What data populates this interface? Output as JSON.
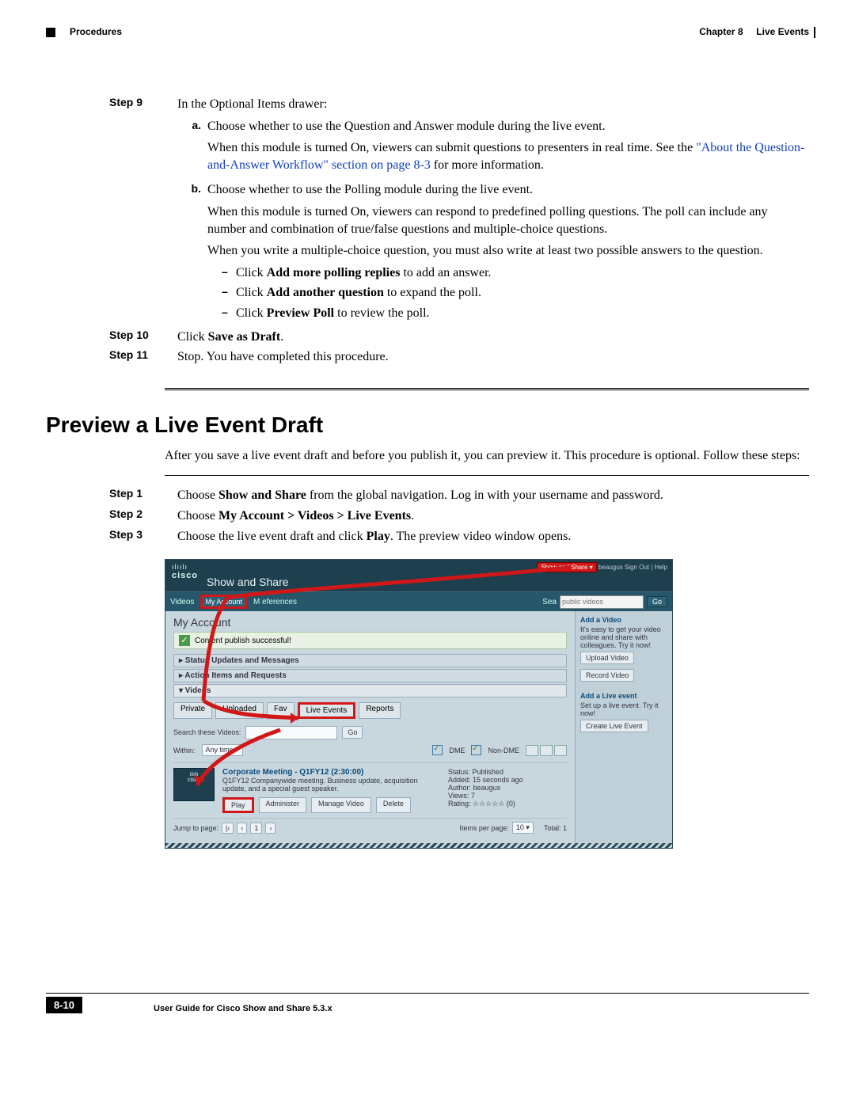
{
  "header": {
    "left": "Procedures",
    "right_chapter": "Chapter 8",
    "right_title": "Live Events"
  },
  "step9": {
    "label": "Step 9",
    "intro": "In the Optional Items drawer:",
    "a": {
      "label": "a.",
      "line1": "Choose whether to use the Question and Answer module during the live event.",
      "line2a": "When this module is turned On, viewers can submit questions to presenters in real time. See the ",
      "link": "\"About the Question-and-Answer Workflow\" section on page 8-3",
      "line2b": " for more information."
    },
    "b": {
      "label": "b.",
      "line1": "Choose whether to use the Polling module during the live event.",
      "line2": "When this module is turned On, viewers can respond to predefined polling questions. The poll can include any number and combination of true/false questions and multiple-choice questions.",
      "line3": "When you write a multiple-choice question, you must also write at least two possible answers to the question.",
      "bullet1a": "Click ",
      "bullet1b": "Add more polling replies",
      "bullet1c": " to add an answer.",
      "bullet2a": "Click ",
      "bullet2b": "Add another question",
      "bullet2c": " to expand the poll.",
      "bullet3a": "Click ",
      "bullet3b": "Preview Poll",
      "bullet3c": " to review the poll."
    }
  },
  "step10": {
    "label": "Step 10",
    "text_a": "Click ",
    "text_b": "Save as Draft",
    "text_c": "."
  },
  "step11": {
    "label": "Step 11",
    "text": "Stop. You have completed this procedure."
  },
  "section_title": "Preview a Live Event Draft",
  "section_intro": "After you save a live event draft and before you publish it, you can preview it. This procedure is optional. Follow these steps:",
  "pstep1": {
    "label": "Step 1",
    "a": "Choose ",
    "b": "Show and Share",
    "c": " from the global navigation. Log in with your username and password."
  },
  "pstep2": {
    "label": "Step 2",
    "a": "Choose ",
    "b": "My Account > Videos > Live Events",
    "c": "."
  },
  "pstep3": {
    "label": "Step 3",
    "a": "Choose the live event draft and click ",
    "b": "Play",
    "c": ". The preview video window opens."
  },
  "screenshot": {
    "brand_top": "ılıılı",
    "brand": "cisco",
    "app": "Show and Share",
    "top_right_pill": "Show and Share ▾",
    "top_right_links": "beaugus Sign Out | Help",
    "nav_videos": "Videos",
    "nav_myaccount": "My Account",
    "nav_pref": "M   eferences",
    "search_placeholder": "public videos",
    "search_lbl": "Sea",
    "go": "Go",
    "main_h": "My Account",
    "ok_msg": "Content publish successful!",
    "drawer1": "▸ Status Updates and Messages",
    "drawer2": "▸ Action Items and Requests",
    "drawer3": "▾ Videos",
    "tabs": [
      "Private",
      "Uploaded",
      "Fav",
      "Live Events",
      "Reports"
    ],
    "search_these": "Search these Videos:",
    "go2": "Go",
    "within": "Within:",
    "anytime": "Any time  ▾",
    "dme": "DME",
    "nondme": "Non-DME",
    "item_title": "Corporate Meeting - Q1FY12  (2:30:00)",
    "item_desc": "Q1FY12 Companywide meeting. Business update, acquisition update, and a special guest speaker.",
    "status_l": "Status:",
    "status_v": "Published",
    "added_l": "Added:",
    "added_v": "15 seconds ago",
    "author_l": "Author:",
    "author_v": "beaugus",
    "views_l": "Views:",
    "views_v": "7",
    "rating_l": "Rating:",
    "rating_v": "☆☆☆☆☆  (0)",
    "btn_play": "Play",
    "btn_admin": "Administer",
    "btn_manage": "Manage Video",
    "btn_delete": "Delete",
    "jump": "Jump to page:",
    "ipp": "Items per page:",
    "ipp_v": "10 ▾",
    "total": "Total: 1",
    "side_addvid": "Add a Video",
    "side_addvid_txt": "It's easy to get your video online and share with colleagues. Try it now!",
    "side_upload": "Upload Video",
    "side_record": "Record Video",
    "side_addlive": "Add a Live event",
    "side_addlive_txt": "Set up a live event. Try it now!",
    "side_create": "Create Live Event"
  },
  "footer": {
    "guide": "User Guide for Cisco Show and Share 5.3.x",
    "page": "8-10"
  }
}
